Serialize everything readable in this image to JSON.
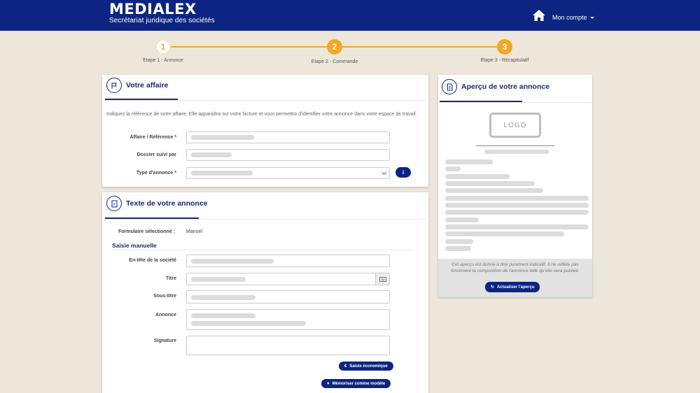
{
  "header": {
    "brand_name": "MEDIALEX",
    "brand_subtitle": "Secrétariat juridique des sociétés",
    "home_icon": "home-icon",
    "account_label": "Mon compte"
  },
  "stepper": {
    "steps": [
      {
        "number": "1",
        "label": "Etape 1 - Annonce",
        "state": "active"
      },
      {
        "number": "2",
        "label": "Etape 2 - Commande",
        "state": "pending"
      },
      {
        "number": "3",
        "label": "Etape 3 - Récapitulatif",
        "state": "pending"
      }
    ],
    "accent_color": "#f5a623"
  },
  "affaire": {
    "title": "Votre affaire",
    "icon": "flag-icon",
    "description": "Indiquez la référence de votre affaire. Elle apparaîtra sur votre facture et vous permettra d'identifier votre annonce dans votre espace de travail.",
    "fields": [
      {
        "label": "Affaire / Référence *",
        "value": ""
      },
      {
        "label": "Dossier suivi par",
        "value": ""
      },
      {
        "label": "Type d'annonce *",
        "value": ""
      }
    ]
  },
  "texte": {
    "title": "Texte de votre annonce",
    "icon": "document-edit-icon",
    "formulaire_label": "Formulaire sélectionné :",
    "formulaire_value": "Manuel",
    "section_title": "Saisie manuelle",
    "fields": [
      {
        "label": "En-tête de la société",
        "value": ""
      },
      {
        "label": "Titre",
        "value": ""
      },
      {
        "label": "Sous-titre",
        "value": ""
      },
      {
        "label": "Annonce",
        "value": ""
      },
      {
        "label": "Signature",
        "value": ""
      }
    ],
    "btn_economique": "Saisie économique",
    "btn_modele": "Mémoriser comme modèle"
  },
  "apercu": {
    "title": "Aperçu de votre annonce",
    "icon": "document-icon",
    "logo_text": "LOGO",
    "note": "Cet aperçu est donné à titre purement indicatif. Il ne reflète pas forcément la composition de l'annonce telle qu'elle sera publiée.",
    "refresh_label": "Actualiser l'aperçu"
  },
  "colors": {
    "brand": "#0c2582",
    "background": "#ede6da",
    "title_text": "#1a2b6d"
  }
}
